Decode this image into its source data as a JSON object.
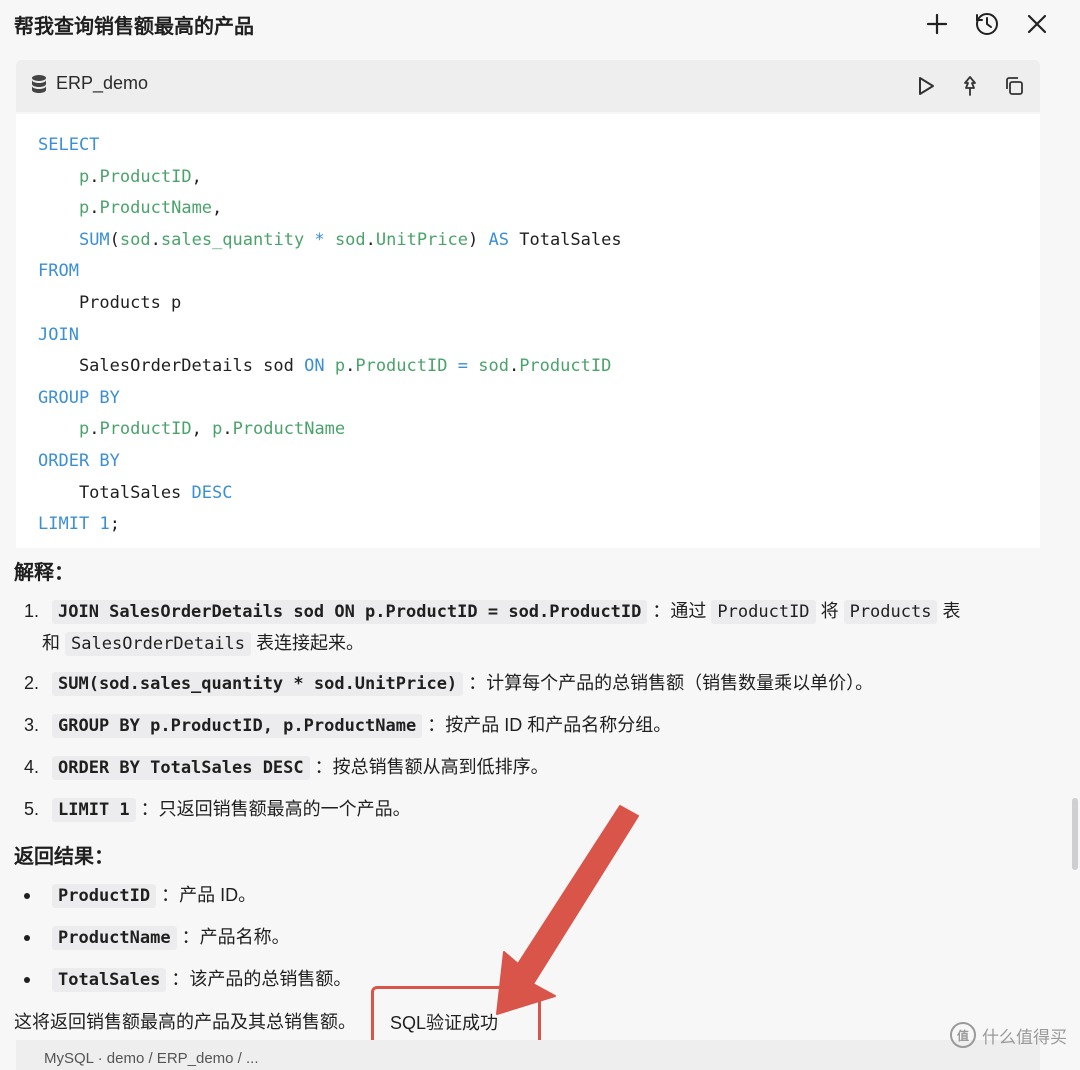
{
  "header": {
    "title": "帮我查询销售额最高的产品"
  },
  "database": {
    "name": "ERP_demo"
  },
  "explain": {
    "heading": "解释：",
    "items": [
      {
        "num": "1.",
        "code": "JOIN SalesOrderDetails sod ON p.ProductID = sod.ProductID",
        "t1": "：通过",
        "c1": "ProductID",
        "t2": "将",
        "c2": "Products",
        "t3": "表",
        "t4": "和",
        "c3": "SalesOrderDetails",
        "t5": "表连接起来。"
      },
      {
        "num": "2.",
        "code": "SUM(sod.sales_quantity * sod.UnitPrice)",
        "text": "：计算每个产品的总销售额（销售数量乘以单价）。"
      },
      {
        "num": "3.",
        "code": "GROUP BY p.ProductID, p.ProductName",
        "text": "：按产品 ID 和产品名称分组。"
      },
      {
        "num": "4.",
        "code": "ORDER BY TotalSales DESC",
        "text": "：按总销售额从高到低排序。"
      },
      {
        "num": "5.",
        "code": "LIMIT 1",
        "text": "：只返回销售额最高的一个产品。"
      }
    ]
  },
  "result": {
    "heading": "返回结果：",
    "items": [
      {
        "code": "ProductID",
        "text": "：产品 ID。"
      },
      {
        "code": "ProductName",
        "text": "：产品名称。"
      },
      {
        "code": "TotalSales",
        "text": "：该产品的总销售额。"
      }
    ]
  },
  "summary": "这将返回销售额最高的产品及其总销售额。",
  "status": "SQL验证成功",
  "next_block": "MySQL · demo / ERP_demo / ...",
  "watermark": "什么值得买",
  "colors": {
    "keyword": "#3b8fd4",
    "field": "#4aa36a",
    "annotation": "#d9554a"
  },
  "icons": [
    "plus-icon",
    "history-icon",
    "close-icon",
    "database-icon",
    "run-icon",
    "pin-icon",
    "copy-icon"
  ]
}
